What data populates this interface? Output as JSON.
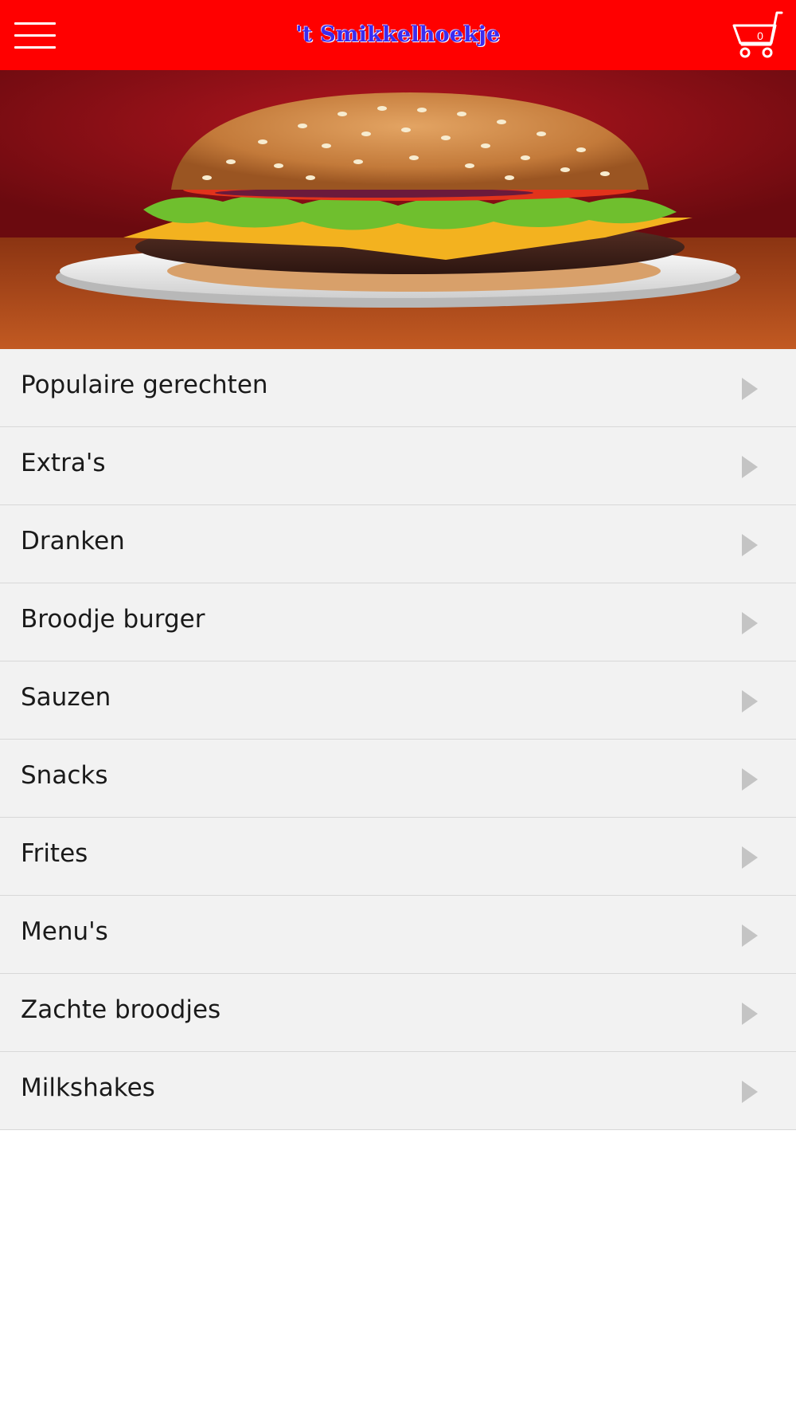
{
  "header": {
    "title": "'t Smikkelhoekje",
    "menu_icon": "hamburger-menu-icon",
    "cart_icon": "shopping-cart-icon",
    "cart_count": "0",
    "background_color": "#ff0000",
    "title_color": "#3a2cf0"
  },
  "hero": {
    "image_subject": "hamburger"
  },
  "categories": {
    "items": [
      {
        "label": "Populaire gerechten"
      },
      {
        "label": "Extra's"
      },
      {
        "label": "Dranken"
      },
      {
        "label": "Broodje burger"
      },
      {
        "label": "Sauzen"
      },
      {
        "label": "Snacks"
      },
      {
        "label": "Frites"
      },
      {
        "label": "Menu's"
      },
      {
        "label": "Zachte broodjes"
      },
      {
        "label": "Milkshakes"
      }
    ],
    "row_background": "#f2f2f2",
    "chevron_icon": "chevron-right-icon"
  }
}
